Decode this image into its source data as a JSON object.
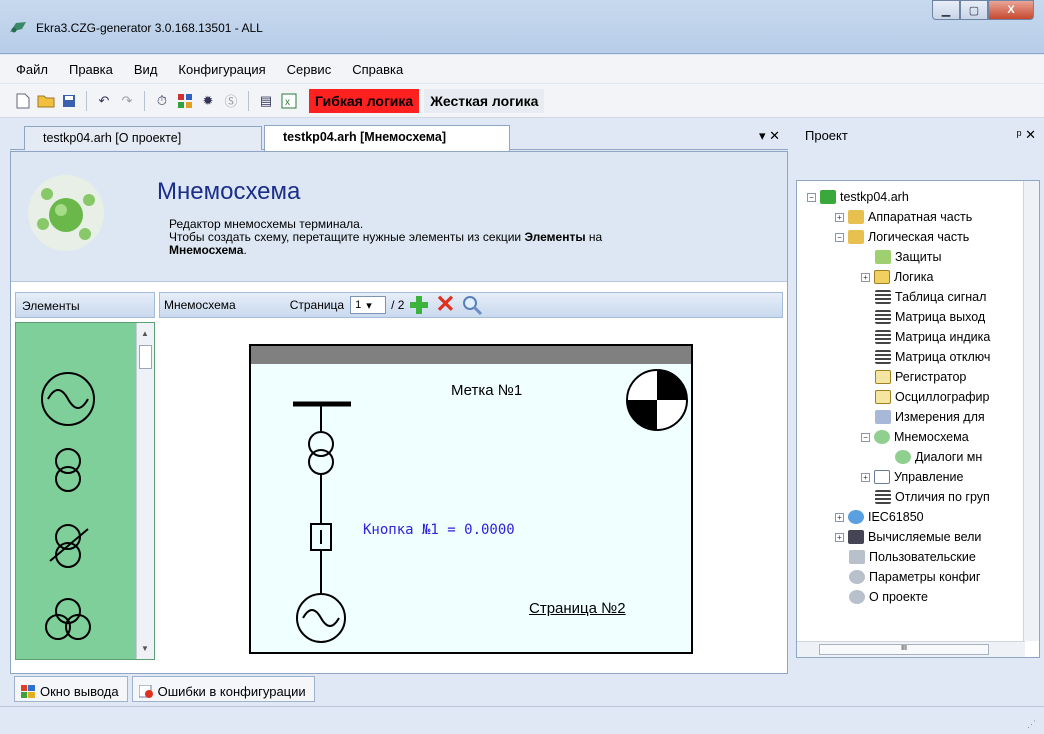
{
  "window": {
    "title": "Ekra3.CZG-generator 3.0.168.13501 - ALL",
    "minimize_label": "▁",
    "maximize_label": "▢",
    "close_label": "X"
  },
  "menu": [
    "Файл",
    "Правка",
    "Вид",
    "Конфигурация",
    "Сервис",
    "Справка"
  ],
  "toolbar": {
    "flex_logic": "Гибкая логика",
    "hard_logic": "Жесткая логика"
  },
  "doc_tabs": {
    "tab1": "testkp04.arh [О проекте]",
    "tab2": "testkp04.arh [Мнемосхема]",
    "controls": "▾ ✕"
  },
  "header": {
    "title": "Мнемосхема",
    "line1": "Редактор мнемосхемы терминала.",
    "line2_pre": "Чтобы создать схему, перетащите нужные элементы из секции ",
    "line2_bold": "Элементы",
    "line2_post": " на",
    "line3_bold": "Мнемосхема",
    "line3_post": "."
  },
  "elements_panel": {
    "label": "Элементы"
  },
  "mnemo_toolbar": {
    "label": "Мнемосхема",
    "page_label": "Страница",
    "page_value": "1",
    "page_total": "/ 2"
  },
  "mnemo": {
    "label_text": "Метка №1",
    "button_text": "Кнопка №1 = 0.0000",
    "link_text": "Страница №2"
  },
  "project": {
    "title": "Проект",
    "pin": "ᵖ ✕",
    "tree": [
      {
        "label": "testkp04.arh",
        "expander": "−"
      },
      {
        "label": "Аппаратная часть",
        "expander": "+"
      },
      {
        "label": "Логическая часть",
        "expander": "−"
      },
      {
        "label": "Защиты",
        "expander": ""
      },
      {
        "label": "Логика",
        "expander": "+"
      },
      {
        "label": "Таблица сигнал",
        "expander": ""
      },
      {
        "label": "Матрица выход",
        "expander": ""
      },
      {
        "label": "Матрица индика",
        "expander": ""
      },
      {
        "label": "Матрица отключ",
        "expander": ""
      },
      {
        "label": "Регистратор",
        "expander": ""
      },
      {
        "label": "Осциллографир",
        "expander": ""
      },
      {
        "label": "Измерения для",
        "expander": ""
      },
      {
        "label": "Мнемосхема",
        "expander": "−"
      },
      {
        "label": "Диалоги мн",
        "expander": ""
      },
      {
        "label": "Управление",
        "expander": "+"
      },
      {
        "label": "Отличия по груп",
        "expander": ""
      },
      {
        "label": "IEC61850",
        "expander": "+"
      },
      {
        "label": "Вычисляемые вели",
        "expander": "+"
      },
      {
        "label": "Пользовательские",
        "expander": ""
      },
      {
        "label": "Параметры конфиг",
        "expander": ""
      },
      {
        "label": "О проекте",
        "expander": ""
      }
    ]
  },
  "bottom_tabs": {
    "output": "Окно вывода",
    "errors": "Ошибки в конфигурации"
  }
}
